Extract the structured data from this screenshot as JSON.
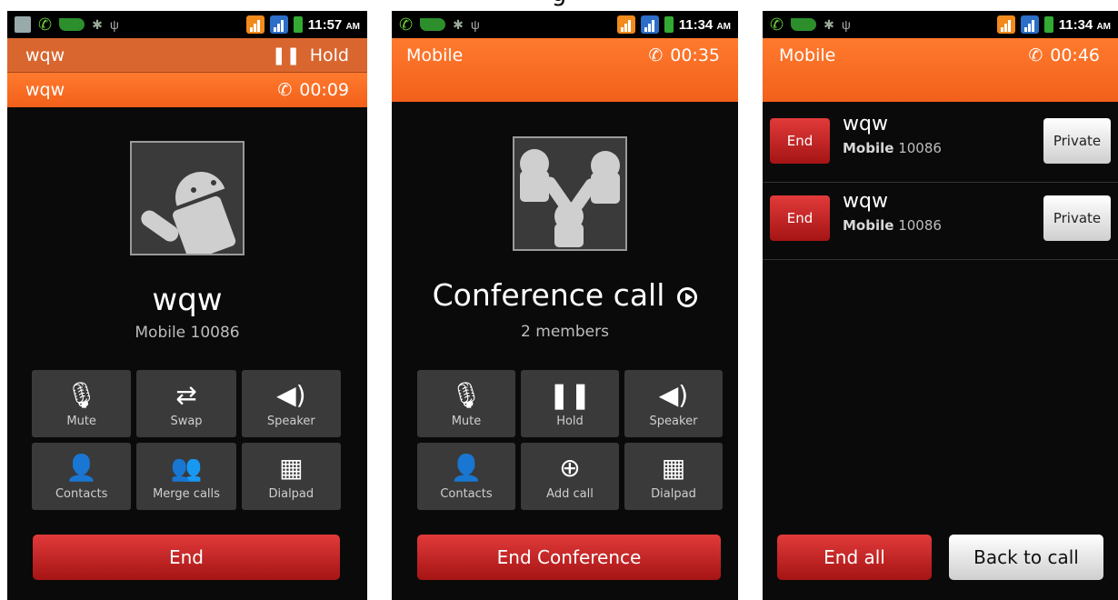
{
  "caption": "g",
  "status": {
    "screen1_time": "11:57",
    "screen2_time": "11:34",
    "screen3_time": "11:34",
    "ampm": "AM"
  },
  "screen1": {
    "held_name": "wqw",
    "held_status": "Hold",
    "active_name": "wqw",
    "active_timer": "00:09",
    "caller_name": "wqw",
    "caller_sub": "Mobile  10086",
    "buttons": [
      "Mute",
      "Swap",
      "Speaker",
      "Contacts",
      "Merge calls",
      "Dialpad"
    ],
    "end_label": "End"
  },
  "screen2": {
    "bar_label": "Mobile",
    "timer": "00:35",
    "title": "Conference call",
    "members": "2 members",
    "buttons": [
      "Mute",
      "Hold",
      "Speaker",
      "Contacts",
      "Add call",
      "Dialpad"
    ],
    "end_label": "End Conference"
  },
  "screen3": {
    "bar_label": "Mobile",
    "timer": "00:46",
    "rows": [
      {
        "end": "End",
        "name": "wqw",
        "type": "Mobile",
        "number": "10086",
        "private": "Private"
      },
      {
        "end": "End",
        "name": "wqw",
        "type": "Mobile",
        "number": "10086",
        "private": "Private"
      }
    ],
    "end_all": "End all",
    "back_to_call": "Back to call"
  },
  "icons": [
    "message-icon",
    "phone-icon",
    "pea-icon",
    "android-icon",
    "usb-icon",
    "signal-icon",
    "battery-icon",
    "mute-icon",
    "swap-icon",
    "speaker-icon",
    "contacts-icon",
    "merge-icon",
    "dialpad-icon",
    "hold-icon",
    "add-call-icon",
    "play-icon"
  ],
  "colors": {
    "accent": "#f2601a",
    "end_red": "#c41f1f",
    "background": "#0a0a0a"
  }
}
